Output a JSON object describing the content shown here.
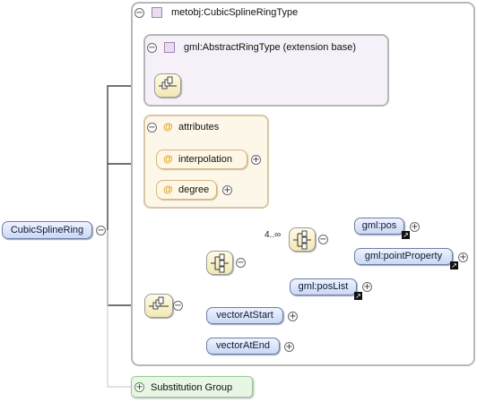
{
  "diagram": {
    "root_element": "CubicSplineRing",
    "type_name": "metobj:CubicSplineRingType",
    "extension_label": "gml:AbstractRingType (extension base)",
    "attributes_label": "attributes",
    "attributes": [
      "interpolation",
      "degree"
    ],
    "occurs_label": "4..∞",
    "choice_elements": [
      "gml:pos",
      "gml:pointProperty"
    ],
    "pos_list": "gml:posList",
    "trailing_elements": [
      "vectorAtStart",
      "vectorAtEnd"
    ],
    "substitution_group": "Substitution Group",
    "collapse_symbol": "−",
    "expand_symbol": "+",
    "attribute_symbol": "@",
    "link_symbol": "↗"
  }
}
